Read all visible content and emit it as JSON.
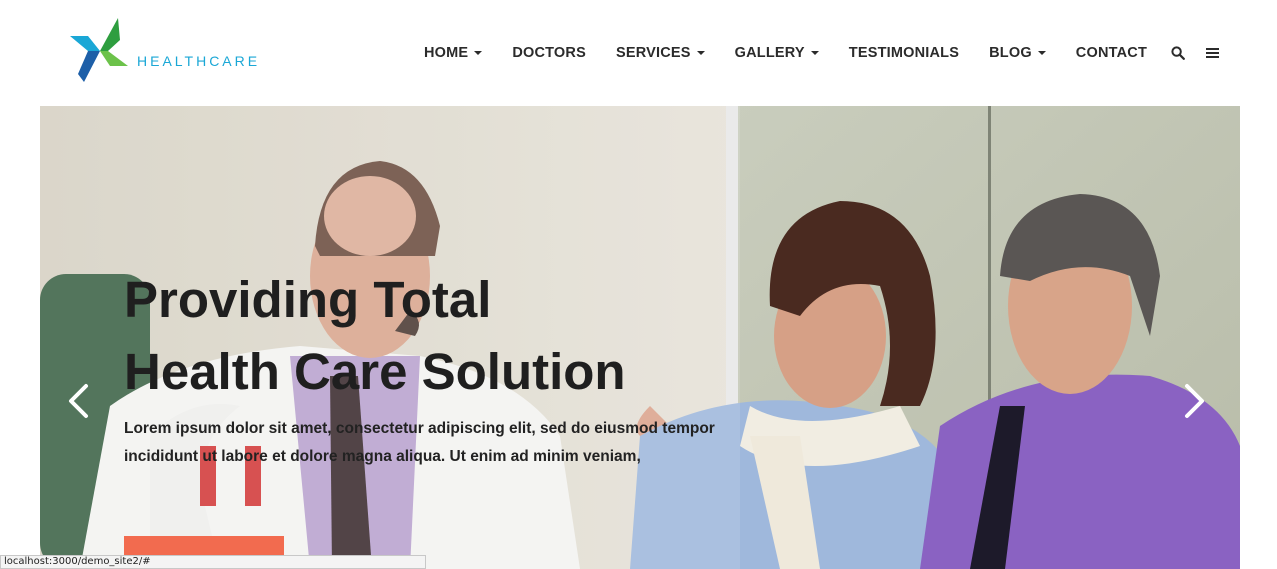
{
  "brand": {
    "name": "HEALTHCARE",
    "colors": {
      "blue": "#1aa7d6",
      "green": "#6cc24a",
      "darkblue": "#1d5fa8",
      "accent": "#f26b4f"
    }
  },
  "nav": {
    "items": [
      {
        "label": "HOME",
        "dropdown": true
      },
      {
        "label": "DOCTORS",
        "dropdown": false
      },
      {
        "label": "SERVICES",
        "dropdown": true
      },
      {
        "label": "GALLERY",
        "dropdown": true
      },
      {
        "label": "TESTIMONIALS",
        "dropdown": false
      },
      {
        "label": "BLOG",
        "dropdown": true
      },
      {
        "label": "CONTACT",
        "dropdown": false
      }
    ],
    "icons": [
      "search-icon",
      "menu-icon"
    ]
  },
  "hero": {
    "title_line1": "Providing Total",
    "title_line2": "Health Care Solution",
    "text": "Lorem ipsum dolor sit amet, consectetur adipiscing elit, sed do eiusmod tempor incididunt ut labore et dolore magna aliqua. Ut enim ad minim veniam,",
    "prev_icon": "chevron-left-icon",
    "next_icon": "chevron-right-icon"
  },
  "statusbar": {
    "url": "localhost:3000/demo_site2/#"
  }
}
